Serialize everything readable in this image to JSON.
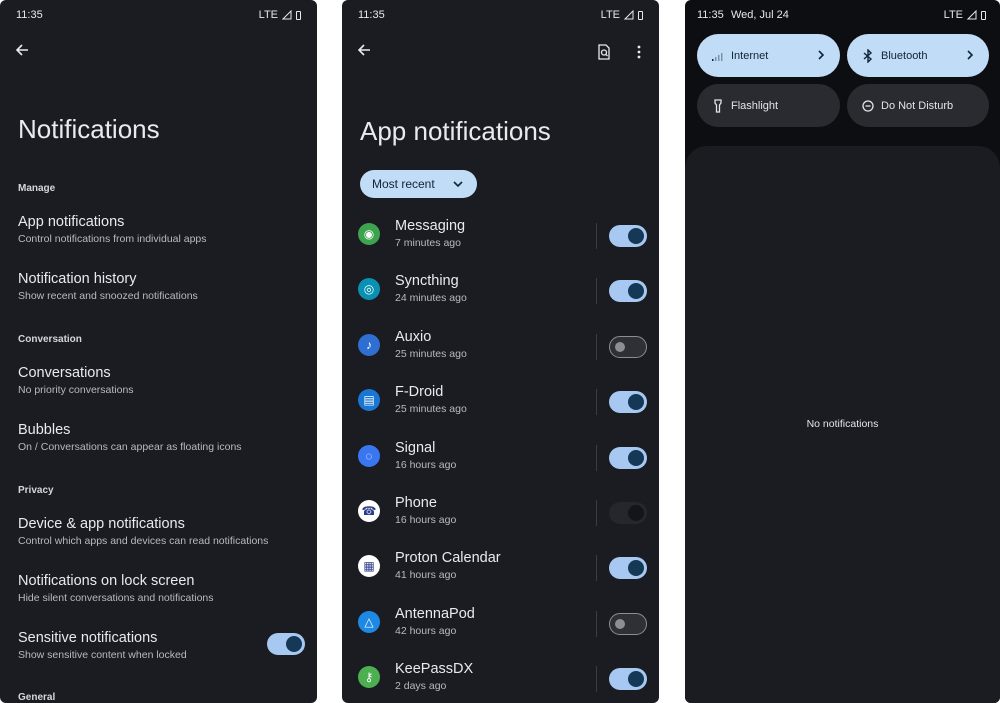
{
  "screen1": {
    "status": {
      "time": "11:35",
      "network": "LTE"
    },
    "title": "Notifications",
    "sections": {
      "manage": "Manage",
      "conversation": "Conversation",
      "privacy": "Privacy",
      "general": "General"
    },
    "items": {
      "app_notifications": {
        "title": "App notifications",
        "subtitle": "Control notifications from individual apps"
      },
      "notification_history": {
        "title": "Notification history",
        "subtitle": "Show recent and snoozed notifications"
      },
      "conversations": {
        "title": "Conversations",
        "subtitle": "No priority conversations"
      },
      "bubbles": {
        "title": "Bubbles",
        "subtitle": "On / Conversations can appear as floating icons"
      },
      "device_app": {
        "title": "Device & app notifications",
        "subtitle": "Control which apps and devices can read notifications"
      },
      "lock_screen": {
        "title": "Notifications on lock screen",
        "subtitle": "Hide silent conversations and notifications"
      },
      "sensitive": {
        "title": "Sensitive notifications",
        "subtitle": "Show sensitive content when locked",
        "enabled": true
      }
    }
  },
  "screen2": {
    "status": {
      "time": "11:35",
      "network": "LTE"
    },
    "title": "App notifications",
    "sort_chip": "Most recent",
    "apps": [
      {
        "name": "Messaging",
        "time": "7 minutes ago",
        "state": "on",
        "icon": "messaging-icon",
        "color": "#3ea34f"
      },
      {
        "name": "Syncthing",
        "time": "24 minutes ago",
        "state": "on",
        "icon": "syncthing-icon",
        "color": "#0891b2"
      },
      {
        "name": "Auxio",
        "time": "25 minutes ago",
        "state": "off",
        "icon": "music-note-icon",
        "color": "#2f6fd1"
      },
      {
        "name": "F-Droid",
        "time": "25 minutes ago",
        "state": "on",
        "icon": "fdroid-icon",
        "color": "#1976d2"
      },
      {
        "name": "Signal",
        "time": "16 hours ago",
        "state": "on",
        "icon": "signal-icon",
        "color": "#3a76f0"
      },
      {
        "name": "Phone",
        "time": "16 hours ago",
        "state": "disabled",
        "icon": "phone-icon",
        "color": "#ffffff"
      },
      {
        "name": "Proton Calendar",
        "time": "41 hours ago",
        "state": "on",
        "icon": "calendar-icon",
        "color": "#ffffff"
      },
      {
        "name": "AntennaPod",
        "time": "42 hours ago",
        "state": "off",
        "icon": "podcast-icon",
        "color": "#1e88e5"
      },
      {
        "name": "KeePassDX",
        "time": "2 days ago",
        "state": "on",
        "icon": "key-icon",
        "color": "#4caf50"
      }
    ]
  },
  "screen3": {
    "status": {
      "time": "11:35",
      "date": "Wed, Jul 24",
      "network": "LTE"
    },
    "tiles": {
      "internet": "Internet",
      "bluetooth": "Bluetooth",
      "flashlight": "Flashlight",
      "dnd": "Do Not Disturb"
    },
    "empty_text": "No notifications"
  }
}
